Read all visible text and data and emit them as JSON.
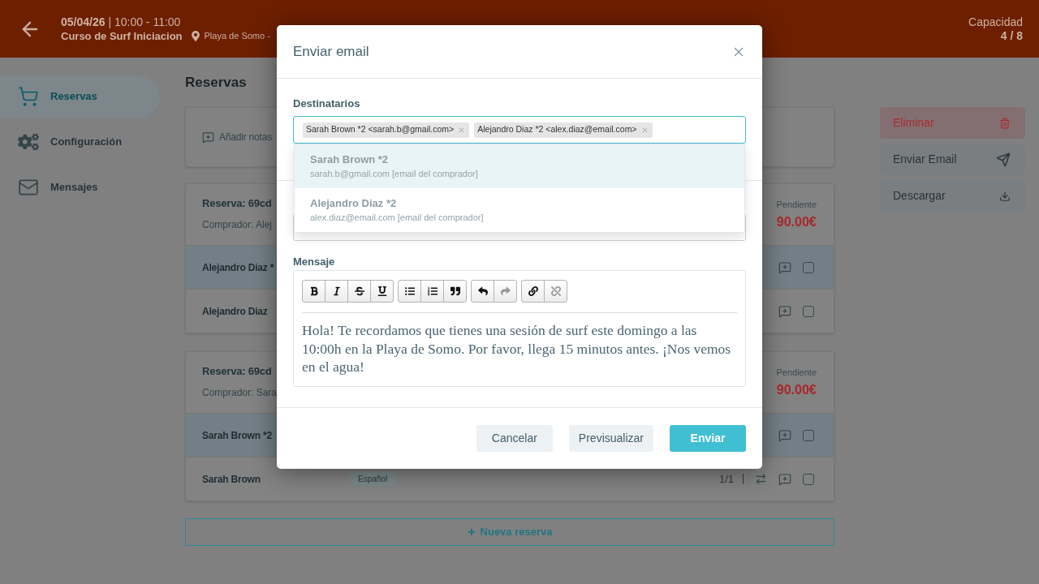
{
  "header": {
    "date_time": "**05/04/26** | 10:00 - 11:00",
    "title": "Curso de Surf Iniciacion",
    "location": "Playa de Somo -",
    "capacity_label": "Capacidad",
    "capacity_value": "4 / 8"
  },
  "sidebar": {
    "items": [
      {
        "label": "Reservas",
        "selected": true
      },
      {
        "label": "Configuración",
        "selected": false
      },
      {
        "label": "Mensajes",
        "selected": false
      }
    ]
  },
  "main": {
    "title": "Reservas",
    "notes_action": "Añadir notas",
    "bookings": [
      {
        "title": "Reserva: 69cd",
        "buyer": "Comprador: Alej",
        "status": "Pendiente",
        "amount": "90.00€",
        "rows": [
          {
            "name": "Alejandro Diaz *",
            "highlighted": true,
            "checked": false
          },
          {
            "name": "Alejandro Diaz",
            "highlighted": false,
            "checked": false
          }
        ]
      },
      {
        "title": "Reserva: 69cd",
        "buyer": "Comprador: Sara",
        "status": "Pendiente",
        "amount": "90.00€",
        "rows": [
          {
            "name": "Sarah Brown *2",
            "highlighted": true,
            "checked": false
          },
          {
            "name": "Sarah Brown",
            "highlighted": false,
            "checked": false,
            "language": "Español",
            "count": "1/1"
          }
        ]
      }
    ],
    "new_booking": "Nueva reserva"
  },
  "actions": [
    {
      "label": "Eliminar",
      "kind": "danger"
    },
    {
      "label": "Enviar Email",
      "kind": "default"
    },
    {
      "label": "Descargar",
      "kind": "default"
    }
  ],
  "modal": {
    "title": "Enviar email",
    "recipients": {
      "label": "Destinatarios",
      "chips": [
        "Sarah Brown *2 <sarah.b@gmail.com>",
        "Alejandro Diaz *2 <alex.diaz@email.com>"
      ]
    },
    "suggestions": [
      {
        "name": "Sarah Brown *2",
        "detail": "sarah.b@gmail.com [email del comprador]",
        "selected": true
      },
      {
        "name": "Alejandro Diaz *2",
        "detail": "alex.diaz@email.com [email del comprador]",
        "selected": false
      }
    ],
    "message": {
      "label": "Mensaje",
      "toolbar_groups": [
        {
          "buttons": [
            {
              "disabled": false
            },
            {
              "disabled": false
            },
            {
              "disabled": false
            },
            {
              "disabled": false
            }
          ]
        },
        {
          "buttons": [
            {
              "disabled": false
            },
            {
              "disabled": false
            },
            {
              "disabled": false
            }
          ]
        },
        {
          "buttons": [
            {
              "disabled": false
            },
            {
              "disabled": true
            }
          ]
        },
        {
          "buttons": [
            {
              "disabled": false
            },
            {
              "disabled": true
            }
          ]
        }
      ],
      "body": "Hola! Te recordamos que tienes una sesión de surf este domingo a las 10:00h en la Playa de Somo. Por favor, llega 15 minutos antes. ¡Nos vemos en el agua!"
    },
    "buttons": [
      {
        "label": "Cancelar",
        "kind": "secondary"
      },
      {
        "label": "Previsualizar",
        "kind": "secondary"
      },
      {
        "label": "Enviar",
        "kind": "primary"
      }
    ]
  }
}
